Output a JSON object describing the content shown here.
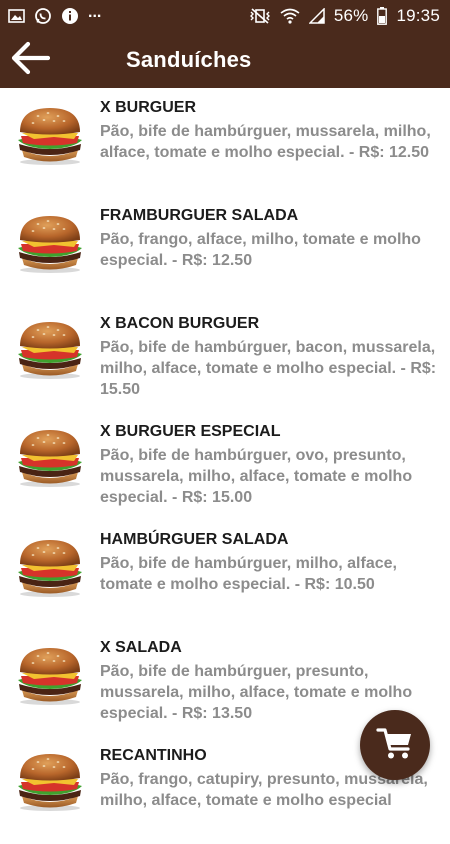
{
  "status_bar": {
    "battery_percent": "56%",
    "time": "19:35",
    "overflow": "...",
    "left_icons": [
      "gallery-notification-icon",
      "whatsapp-notification-icon",
      "info-notification-icon"
    ],
    "right_icons": [
      "vibrate-mute-icon",
      "wifi-icon",
      "signal-icon",
      "battery-icon"
    ]
  },
  "app_bar": {
    "title": "Sanduíches",
    "back_icon": "back-arrow-icon",
    "background": "#4a2a1c"
  },
  "items": [
    {
      "name": "X BURGUER",
      "desc": "Pão, bife de hambúrguer, mussarela, milho, alface, tomate e molho especial.  - R$: 12.50"
    },
    {
      "name": "FRAMBURGUER SALADA",
      "desc": "Pão, frango, alface, milho, tomate e molho especial.  - R$: 12.50"
    },
    {
      "name": "X BACON BURGUER",
      "desc": "Pão, bife de hambúrguer, bacon, mussarela, milho, alface, tomate e molho especial.  - R$: 15.50"
    },
    {
      "name": "X BURGUER ESPECIAL",
      "desc": "Pão, bife de hambúrguer, ovo, presunto, mussarela, milho, alface, tomate e molho especial.  - R$: 15.00"
    },
    {
      "name": "HAMBÚRGUER SALADA",
      "desc": "Pão, bife de hambúrguer, milho, alface, tomate e molho especial.  - R$: 10.50"
    },
    {
      "name": "X SALADA",
      "desc": "Pão, bife de hambúrguer, presunto, mussarela, milho, alface, tomate e molho especial.  - R$: 13.50"
    },
    {
      "name": "RECANTINHO",
      "desc": "Pão, frango, catupiry, presunto, mussarela, milho, alface, tomate e molho especial"
    }
  ],
  "fab": {
    "icon": "shopping-cart-icon"
  },
  "colors": {
    "brand": "#4a2a1c",
    "item_name": "#1c1c1c",
    "item_desc": "#8c8c8c"
  }
}
